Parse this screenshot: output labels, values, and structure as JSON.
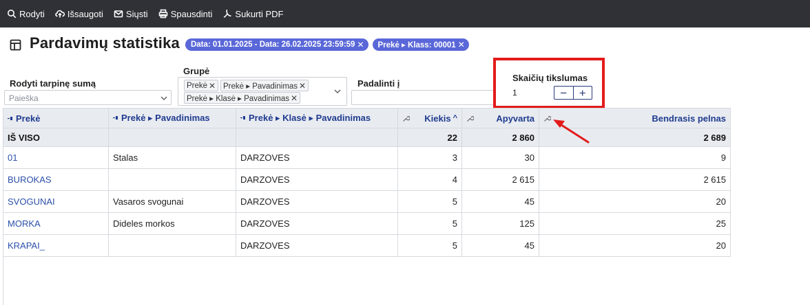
{
  "toolbar": {
    "buttons": [
      {
        "label": "Rodyti",
        "icon": "search-icon"
      },
      {
        "label": "Išsaugoti",
        "icon": "cloud-upload-icon"
      },
      {
        "label": "Siųsti",
        "icon": "mail-icon"
      },
      {
        "label": "Spausdinti",
        "icon": "printer-icon"
      },
      {
        "label": "Sukurti PDF",
        "icon": "pdf-icon"
      }
    ]
  },
  "header": {
    "title": "Pardavimų statistika",
    "filters": [
      {
        "label": "Data: 01.01.2025 - Data: 26.02.2025 23:59:59"
      },
      {
        "label": "Prekė ▸ Klass: 00001"
      }
    ]
  },
  "controls": {
    "subtotal_label": "Rodyti tarpinę sumą",
    "search_placeholder": "Paieška",
    "group_label": "Grupė",
    "group_tags": [
      "Prekė",
      "Prekė ▸ Pavadinimas",
      "Prekė ▸ Klasė ▸ Pavadinimas"
    ],
    "split_label": "Padalinti į"
  },
  "precision_popup": {
    "title": "Skaičių tikslumas",
    "value": "1",
    "minus": "−",
    "plus": "+"
  },
  "table": {
    "columns": [
      "Prekė",
      "Prekė ▸ Pavadinimas",
      "Prekė ▸ Klasė ▸ Pavadinimas",
      "Kiekis",
      "Apyvarta",
      "Bendrasis pelnas"
    ],
    "sort_indicator": "^",
    "total": {
      "label": "IŠ VISO",
      "qty": "22",
      "turnover": "2 860",
      "profit": "2 689"
    },
    "rows": [
      {
        "code": "01",
        "name": "Stalas",
        "class": "DARZOVES",
        "qty": "3",
        "turnover": "30",
        "profit": "9"
      },
      {
        "code": "BUROKAS",
        "name": "",
        "class": "DARZOVES",
        "qty": "4",
        "turnover": "2 615",
        "profit": "2 615"
      },
      {
        "code": "SVOGUNAI",
        "name": "Vasaros svogunai",
        "class": "DARZOVES",
        "qty": "5",
        "turnover": "45",
        "profit": "20"
      },
      {
        "code": "MORKA",
        "name": "Dideles morkos",
        "class": "DARZOVES",
        "qty": "5",
        "turnover": "125",
        "profit": "25"
      },
      {
        "code": "KRAPAI_",
        "name": "",
        "class": "DARZOVES",
        "qty": "5",
        "turnover": "45",
        "profit": "20"
      }
    ]
  },
  "colors": {
    "toolbar_bg": "#2f3136",
    "chip_bg": "#5a67d8",
    "header_text": "#1f3b8f",
    "link": "#2a4fa8",
    "highlight": "#e31b1b"
  }
}
